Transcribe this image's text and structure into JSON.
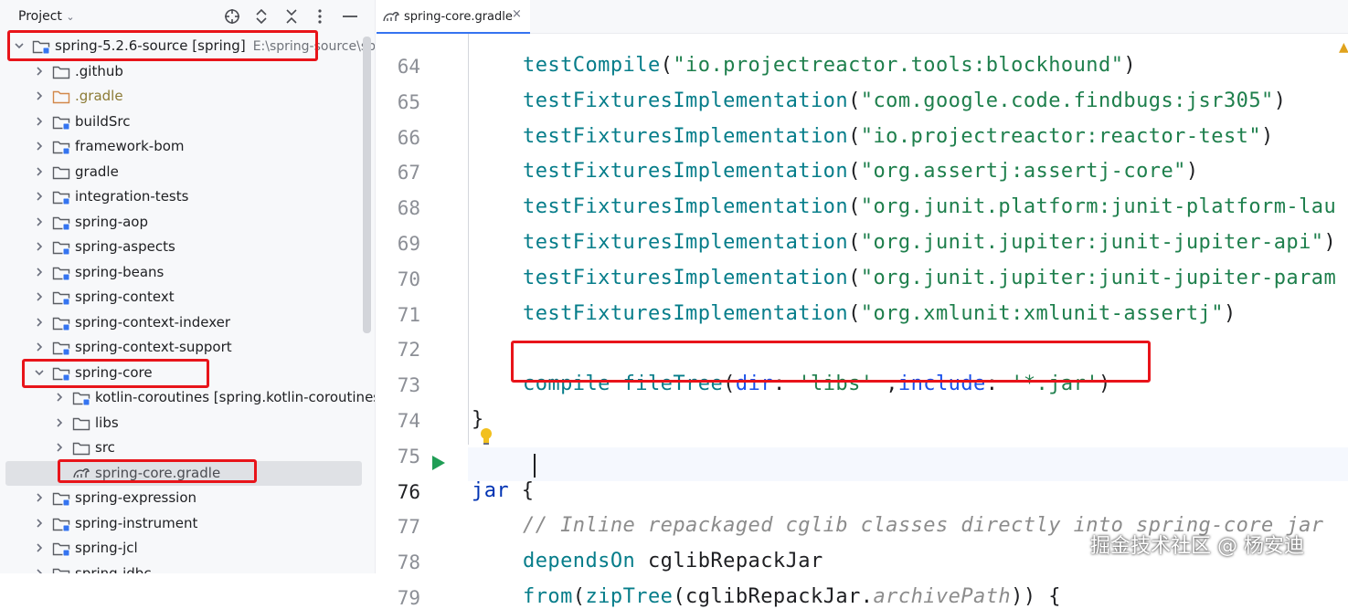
{
  "project_panel": {
    "title": "Project",
    "icons": [
      "crosshair-icon",
      "expand-collapse-icon",
      "collapse-all-icon",
      "more-icon",
      "minimize-icon"
    ],
    "tree": [
      {
        "label": "spring-5.2.6-source [spring]",
        "extra": "E:\\spring-source\\spri",
        "type": "module",
        "expanded": true,
        "depth": 0
      },
      {
        "label": ".github",
        "type": "folder",
        "depth": 1
      },
      {
        "label": ".gradle",
        "type": "folder-excluded",
        "depth": 1
      },
      {
        "label": "buildSrc",
        "type": "module",
        "depth": 1
      },
      {
        "label": "framework-bom",
        "type": "module",
        "depth": 1
      },
      {
        "label": "gradle",
        "type": "folder",
        "depth": 1
      },
      {
        "label": "integration-tests",
        "type": "module",
        "depth": 1
      },
      {
        "label": "spring-aop",
        "type": "module",
        "depth": 1
      },
      {
        "label": "spring-aspects",
        "type": "module",
        "depth": 1
      },
      {
        "label": "spring-beans",
        "type": "module",
        "depth": 1
      },
      {
        "label": "spring-context",
        "type": "module",
        "depth": 1
      },
      {
        "label": "spring-context-indexer",
        "type": "module",
        "depth": 1
      },
      {
        "label": "spring-context-support",
        "type": "module",
        "depth": 1
      },
      {
        "label": "spring-core",
        "type": "module",
        "expanded": true,
        "depth": 1
      },
      {
        "label": "kotlin-coroutines [spring.kotlin-coroutines]",
        "type": "module",
        "depth": 2
      },
      {
        "label": "libs",
        "type": "folder",
        "depth": 2
      },
      {
        "label": "src",
        "type": "folder",
        "depth": 2
      },
      {
        "label": "spring-core.gradle",
        "type": "gradle-file",
        "depth": 2,
        "selected": true
      },
      {
        "label": "spring-expression",
        "type": "module",
        "depth": 1
      },
      {
        "label": "spring-instrument",
        "type": "module",
        "depth": 1
      },
      {
        "label": "spring-jcl",
        "type": "module",
        "depth": 1
      },
      {
        "label": "spring-jdbc",
        "type": "module",
        "depth": 1
      }
    ]
  },
  "editor": {
    "tab": {
      "label": "spring-core.gradle",
      "close": "×"
    },
    "lines": [
      {
        "n": "64",
        "parts": [
          [
            "fn",
            "testCompile"
          ],
          [
            "plain",
            "("
          ],
          [
            "str",
            "\"io.projectreactor.tools:blockhound\""
          ],
          [
            "plain",
            ")"
          ]
        ]
      },
      {
        "n": "65",
        "parts": [
          [
            "fn",
            "testFixturesImplementation"
          ],
          [
            "plain",
            "("
          ],
          [
            "str",
            "\"com.google.code.findbugs:jsr305\""
          ],
          [
            "plain",
            ")"
          ]
        ]
      },
      {
        "n": "66",
        "parts": [
          [
            "fn",
            "testFixturesImplementation"
          ],
          [
            "plain",
            "("
          ],
          [
            "str",
            "\"io.projectreactor:reactor-test\""
          ],
          [
            "plain",
            ")"
          ]
        ]
      },
      {
        "n": "67",
        "parts": [
          [
            "fn",
            "testFixturesImplementation"
          ],
          [
            "plain",
            "("
          ],
          [
            "str",
            "\"org.assertj:assertj-core\""
          ],
          [
            "plain",
            ")"
          ]
        ]
      },
      {
        "n": "68",
        "parts": [
          [
            "fn",
            "testFixturesImplementation"
          ],
          [
            "plain",
            "("
          ],
          [
            "str",
            "\"org.junit.platform:junit-platform-lau"
          ]
        ]
      },
      {
        "n": "69",
        "parts": [
          [
            "fn",
            "testFixturesImplementation"
          ],
          [
            "plain",
            "("
          ],
          [
            "str",
            "\"org.junit.jupiter:junit-jupiter-api\""
          ],
          [
            "plain",
            ")"
          ]
        ]
      },
      {
        "n": "70",
        "parts": [
          [
            "fn",
            "testFixturesImplementation"
          ],
          [
            "plain",
            "("
          ],
          [
            "str",
            "\"org.junit.jupiter:junit-jupiter-param"
          ]
        ]
      },
      {
        "n": "71",
        "parts": [
          [
            "fn",
            "testFixturesImplementation"
          ],
          [
            "plain",
            "("
          ],
          [
            "str",
            "\"org.xmlunit:xmlunit-assertj\""
          ],
          [
            "plain",
            ")"
          ]
        ]
      },
      {
        "n": "72",
        "parts": []
      },
      {
        "n": "73",
        "parts": [
          [
            "fn",
            "compile"
          ],
          [
            "plain",
            " "
          ],
          [
            "fn",
            "fileTree"
          ],
          [
            "plain",
            "("
          ],
          [
            "named",
            "dir"
          ],
          [
            "plain",
            ": "
          ],
          [
            "str",
            "'libs'"
          ],
          [
            "plain",
            " ,"
          ],
          [
            "named",
            "include"
          ],
          [
            "plain",
            ": "
          ],
          [
            "str",
            "'*.jar'"
          ],
          [
            "plain",
            ")"
          ]
        ]
      },
      {
        "n": "74",
        "parts": [
          [
            "plain",
            "}"
          ]
        ]
      },
      {
        "n": "75",
        "parts": []
      },
      {
        "n": "76",
        "parts": [
          [
            "kw",
            "jar"
          ],
          [
            "plain",
            " {"
          ]
        ]
      },
      {
        "n": "77",
        "parts": [
          [
            "cm",
            "// Inline repackaged cglib classes directly into spring-core jar"
          ]
        ]
      },
      {
        "n": "78",
        "parts": [
          [
            "fn",
            "dependsOn"
          ],
          [
            "plain",
            " cglibRepackJar"
          ]
        ]
      },
      {
        "n": "79",
        "parts": [
          [
            "fn",
            "from"
          ],
          [
            "plain",
            "("
          ],
          [
            "fn",
            "zipTree"
          ],
          [
            "plain",
            "(cglibRepackJar."
          ],
          [
            "cm",
            "archivePath"
          ],
          [
            "plain",
            ")) {"
          ]
        ]
      }
    ]
  },
  "watermark": "掘金技术社区 @ 杨安迪"
}
